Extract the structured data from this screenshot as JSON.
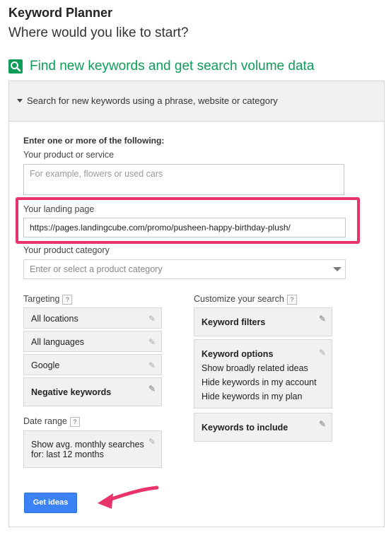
{
  "header": {
    "title": "Keyword Planner",
    "subtitle": "Where would you like to start?"
  },
  "section": {
    "title": "Find new keywords and get search volume data",
    "panel_label": "Search for new keywords using a phrase, website or category"
  },
  "form": {
    "intro": "Enter one or more of the following:",
    "product_label": "Your product or service",
    "product_placeholder": "For example, flowers or used cars",
    "landing_label": "Your landing page",
    "landing_value": "https://pages.landingcube.com/promo/pusheen-happy-birthday-plush/",
    "category_label": "Your product category",
    "category_placeholder": "Enter or select a product category"
  },
  "targeting": {
    "label": "Targeting",
    "help": "?",
    "items": [
      "All locations",
      "All languages",
      "Google",
      "Negative keywords"
    ]
  },
  "date_range": {
    "label": "Date range",
    "help": "?",
    "value_line1": "Show avg. monthly searches",
    "value_line2": "for: last 12 months"
  },
  "customize": {
    "label": "Customize your search",
    "help": "?",
    "filters": "Keyword filters",
    "options_title": "Keyword options",
    "options": [
      "Show broadly related ideas",
      "Hide keywords in my account",
      "Hide keywords in my plan"
    ],
    "include": "Keywords to include"
  },
  "actions": {
    "get_ideas": "Get ideas"
  },
  "colors": {
    "accent_green": "#0f9d58",
    "highlight_pink": "#e8336b",
    "button_blue": "#3b82f6"
  }
}
